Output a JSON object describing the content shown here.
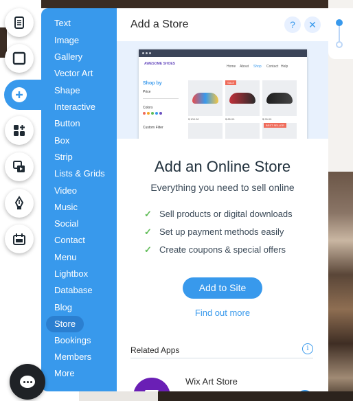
{
  "rail": {
    "buttons": [
      "pages-icon",
      "background-icon",
      "add-icon",
      "add-apps-icon",
      "media-icon",
      "pen-icon",
      "business-icon"
    ]
  },
  "menu": {
    "items": [
      "Text",
      "Image",
      "Gallery",
      "Vector Art",
      "Shape",
      "Interactive",
      "Button",
      "Box",
      "Strip",
      "Lists & Grids",
      "Video",
      "Music",
      "Social",
      "Contact",
      "Menu",
      "Lightbox",
      "Database",
      "Blog",
      "Store",
      "Bookings",
      "Members",
      "More"
    ],
    "selected": "Store"
  },
  "panel": {
    "title": "Add a Store",
    "help_label": "?",
    "close_label": "✕"
  },
  "preview": {
    "logo": "AWESOME SHOES",
    "nav": [
      "Home",
      "About",
      "Shop",
      "Contact",
      "Help"
    ],
    "shop_by": "Shop by",
    "filters": [
      "Price",
      "Colors",
      "Custom Filter"
    ],
    "tags": [
      "SALE",
      "BEST SELLER"
    ],
    "prices": [
      "$ 100.00",
      "$ 85.00",
      "$ 90.00"
    ]
  },
  "content": {
    "title": "Add an Online Store",
    "subtitle": "Everything you need to sell online",
    "features": [
      "Sell products or digital downloads",
      "Set up payment methods easily",
      "Create coupons & special offers"
    ],
    "add_button": "Add to Site",
    "find_more": "Find out more"
  },
  "related": {
    "title": "Related Apps",
    "info_label": "i",
    "app_name": "Wix Art Store"
  },
  "colors": {
    "accent": "#3899ec",
    "menu_selected": "#2b7fd0",
    "check": "#60bc57",
    "app_icon": "#6a1fb5"
  }
}
